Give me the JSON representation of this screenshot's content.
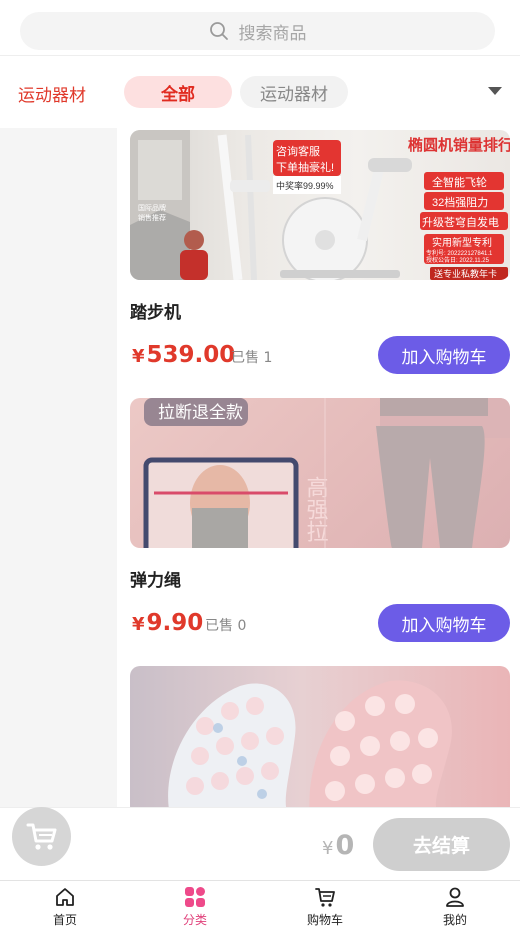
{
  "search": {
    "placeholder": "搜索商品"
  },
  "category": {
    "current": "运动器材",
    "chips": [
      "全部",
      "运动器材"
    ]
  },
  "products": [
    {
      "name": "踏步机",
      "price": "539.00",
      "sold": "已售 1",
      "button": "加入购物车",
      "image_texts": [
        "咨询客服",
        "下单抽豪礼!",
        "中奖率99.99%",
        "椭圆机销量排行",
        "全智能飞轮",
        "32档强阻力",
        "升级苍穹自发电",
        "实用新型专利",
        "专利号: 202222127841.1",
        "授权公告日: 2022.11.25",
        "送专业私教年卡",
        "国际品牌",
        "销售推荐"
      ]
    },
    {
      "name": "弹力绳",
      "price": "9.90",
      "sold": "已售 0",
      "button": "加入购物车",
      "image_texts": [
        "拉断退全款",
        "高强拉"
      ]
    }
  ],
  "currency": "¥",
  "checkout": {
    "total": "0",
    "button": "去结算"
  },
  "tabs": [
    {
      "label": "首页",
      "icon": "home-icon"
    },
    {
      "label": "分类",
      "icon": "category-grid-icon"
    },
    {
      "label": "购物车",
      "icon": "cart-icon"
    },
    {
      "label": "我的",
      "icon": "profile-icon"
    }
  ],
  "colors": {
    "accent_red": "#e0392b",
    "button_purple": "#6c5ce7",
    "tab_active": "#e0407a",
    "chip_bg": "#fde0e0"
  }
}
